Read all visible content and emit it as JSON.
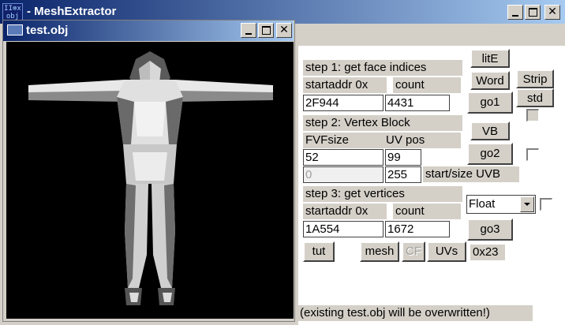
{
  "main_window": {
    "title": "MeshExtractor",
    "title_prefix": "-",
    "icon_text": [
      "II⊗x",
      "obj"
    ],
    "icon_name": "app-icon",
    "controls": {
      "minimize": "minimize-icon",
      "maximize": "maximize-icon",
      "close": "✕"
    }
  },
  "child_window": {
    "title": "test.obj",
    "icon_name": "obj-file-icon",
    "controls": {
      "minimize": "minimize-icon",
      "maximize": "maximize-icon",
      "close": "✕"
    },
    "viewport": {
      "background": "#000000",
      "content": "3d-figure-mesh"
    }
  },
  "step1": {
    "heading": "step 1: get face indices",
    "startaddr_label": "startaddr 0x",
    "count_label": "count",
    "startaddr_value": "2F944",
    "count_value": "4431"
  },
  "step2": {
    "heading": "step 2: Vertex Block",
    "fvfsize_label": "FVFsize",
    "uvpos_label": "UV pos",
    "fvfsize_value": "52",
    "uvpos_value": "99",
    "start_value": "0",
    "size_value": "255",
    "start_size_label": "start/size UVB"
  },
  "step3": {
    "heading": "step 3: get vertices",
    "startaddr_label": "startaddr 0x",
    "count_label": "count",
    "startaddr_value": "1A554",
    "count_value": "1672",
    "format_select": "Float"
  },
  "buttons": {
    "lite": "litE",
    "word": "Word",
    "strip": "Strip",
    "go1": "go1",
    "std": "std",
    "vb": "VB",
    "go2": "go2",
    "go3": "go3",
    "tut": "tut",
    "mesh": "mesh",
    "cf": "CF",
    "uvs": "UVs"
  },
  "hex_readout": "0x23",
  "status_note": "(existing test.obj will be overwritten!)",
  "colors": {
    "titlebar_start": "#0a246a",
    "titlebar_end": "#a6caf0",
    "face": "#d4d0c8",
    "viewport": "#000000"
  }
}
